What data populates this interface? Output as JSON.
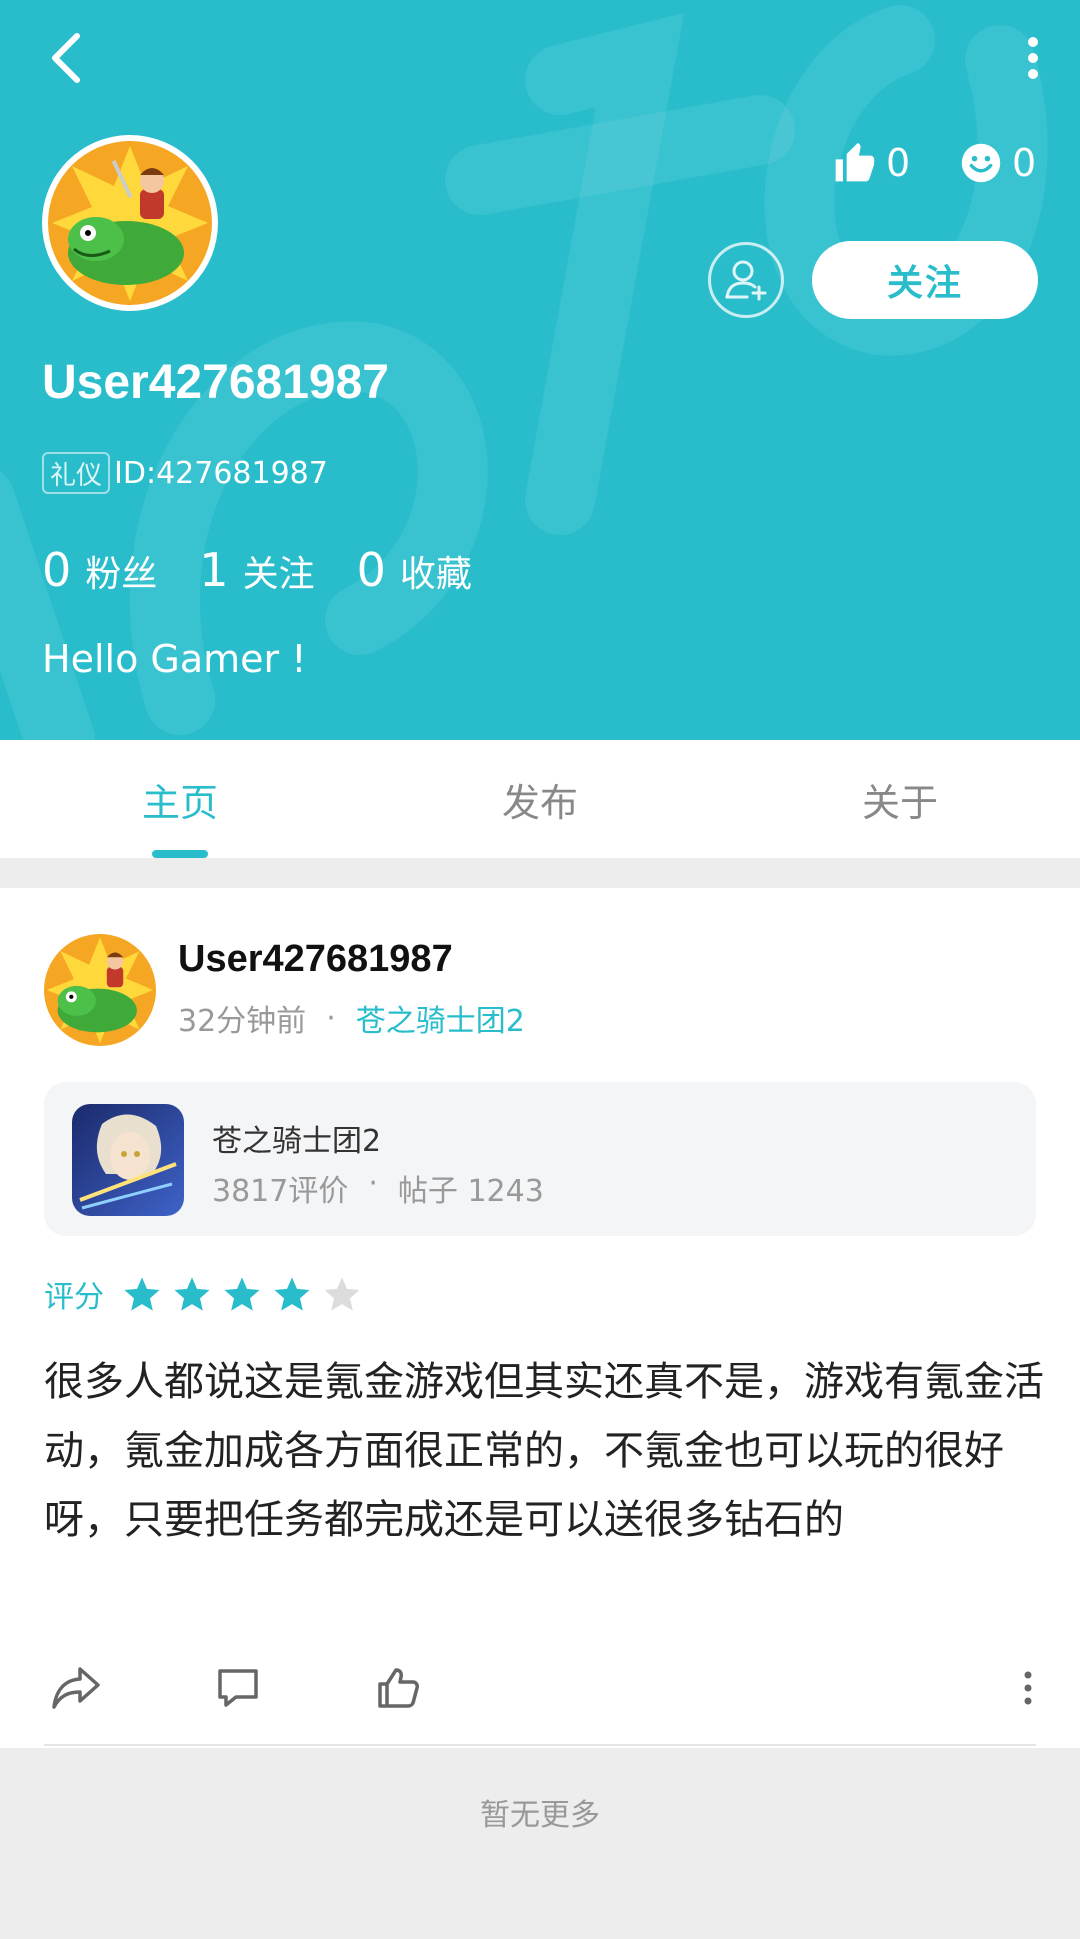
{
  "header": {
    "username": "User427681987",
    "badge": "礼仪",
    "id_text": "ID:427681987",
    "likes_count": "0",
    "smile_count": "0",
    "follow_label": "关注",
    "bio": "Hello Gamer !",
    "counts": [
      {
        "num": "0",
        "label": "粉丝"
      },
      {
        "num": "1",
        "label": "关注"
      },
      {
        "num": "0",
        "label": "收藏"
      }
    ],
    "accent": "#29bdcc"
  },
  "tabs": [
    {
      "label": "主页",
      "active": true
    },
    {
      "label": "发布",
      "active": false
    },
    {
      "label": "关于",
      "active": false
    }
  ],
  "post": {
    "author": "User427681987",
    "time": "32分钟前",
    "separator": "·",
    "game_link": "苍之骑士团2",
    "game": {
      "name": "苍之骑士团2",
      "reviews": "3817评价",
      "posts": "帖子 1243"
    },
    "rating_label": "评分",
    "rating": 4,
    "rating_max": 5,
    "text": "很多人都说这是氪金游戏但其实还真不是，游戏有氪金活动，氪金加成各方面很正常的，不氪金也可以玩的很好呀，只要把任务都完成还是可以送很多钻石的"
  },
  "icons": {
    "back": "back-arrow-icon",
    "more": "more-vertical-icon",
    "like": "thumbs-up-icon",
    "smile": "smile-icon",
    "add_friend": "add-user-icon",
    "share": "share-icon",
    "comment": "comment-icon",
    "post_like": "thumbs-up-outline-icon",
    "post_more": "more-vertical-icon"
  },
  "footer": {
    "no_more": "暂无更多"
  }
}
